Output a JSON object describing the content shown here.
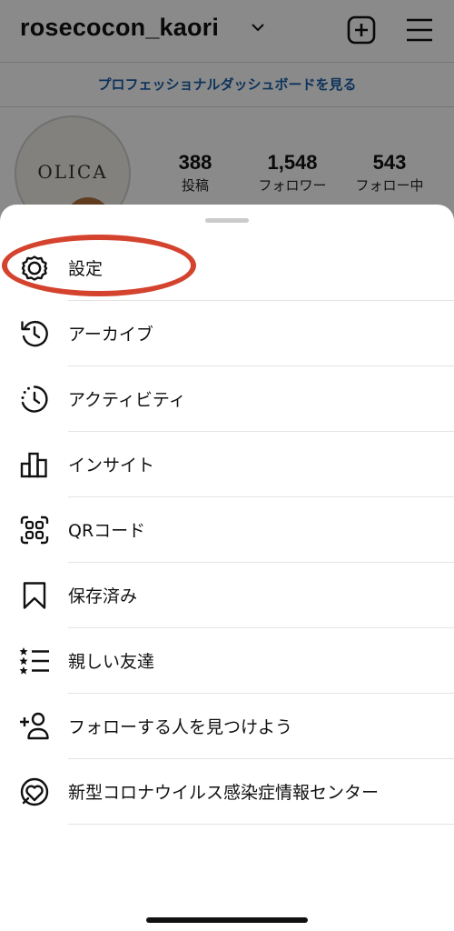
{
  "header": {
    "username": "rosecocon_kaori",
    "pro_dashboard_link": "プロフェッショナルダッシュボードを見る"
  },
  "profile": {
    "avatar_text": "OLICA",
    "stats": [
      {
        "value": "388",
        "label": "投稿"
      },
      {
        "value": "1,548",
        "label": "フォロワー"
      },
      {
        "value": "543",
        "label": "フォロー中"
      }
    ]
  },
  "menu": {
    "items": [
      {
        "label": "設定",
        "icon": "settings-gear-icon"
      },
      {
        "label": "アーカイブ",
        "icon": "archive-history-icon"
      },
      {
        "label": "アクティビティ",
        "icon": "activity-clock-icon"
      },
      {
        "label": "インサイト",
        "icon": "insights-bar-chart-icon"
      },
      {
        "label": "QRコード",
        "icon": "qr-code-icon"
      },
      {
        "label": "保存済み",
        "icon": "bookmark-icon"
      },
      {
        "label": "親しい友達",
        "icon": "close-friends-list-icon"
      },
      {
        "label": "フォローする人を見つけよう",
        "icon": "discover-people-icon"
      },
      {
        "label": "新型コロナウイルス感染症情報センター",
        "icon": "covid-info-center-icon"
      }
    ]
  },
  "colors": {
    "annotation": "#d4432e",
    "link": "#1a5fa8"
  }
}
